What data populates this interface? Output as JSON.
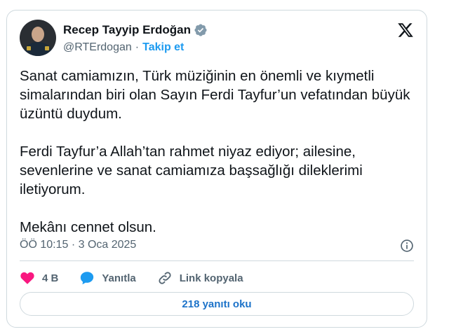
{
  "author": {
    "name": "Recep Tayyip Erdoğan",
    "handle": "@RTErdogan",
    "separator": "·",
    "follow_label": "Takip et"
  },
  "tweet": {
    "text": "Sanat camiamızın, Türk müziğinin en önemli ve kıymetli simalarından biri olan Sayın Ferdi Tayfur’un vefatından büyük üzüntü duydum.\n\nFerdi Tayfur’a Allah’tan rahmet niyaz ediyor; ailesine, sevenlerine ve sanat camiamıza başsağlığı dileklerimi iletiyorum.\n\nMekânı cennet olsun.",
    "timestamp": "ÖÖ 10:15 · 3 Oca 2025"
  },
  "actions": {
    "likes": "4 B",
    "reply_label": "Yanıtla",
    "copy_link_label": "Link kopyala"
  },
  "read_replies_label": "218 yanıtı oku",
  "colors": {
    "accent": "#1d9bf0",
    "like": "#f91880",
    "reply": "#1d9bf0",
    "muted": "#536471"
  },
  "icons": [
    "verified-badge-icon",
    "x-logo-icon",
    "info-icon",
    "heart-icon",
    "reply-bubble-icon",
    "link-icon"
  ]
}
